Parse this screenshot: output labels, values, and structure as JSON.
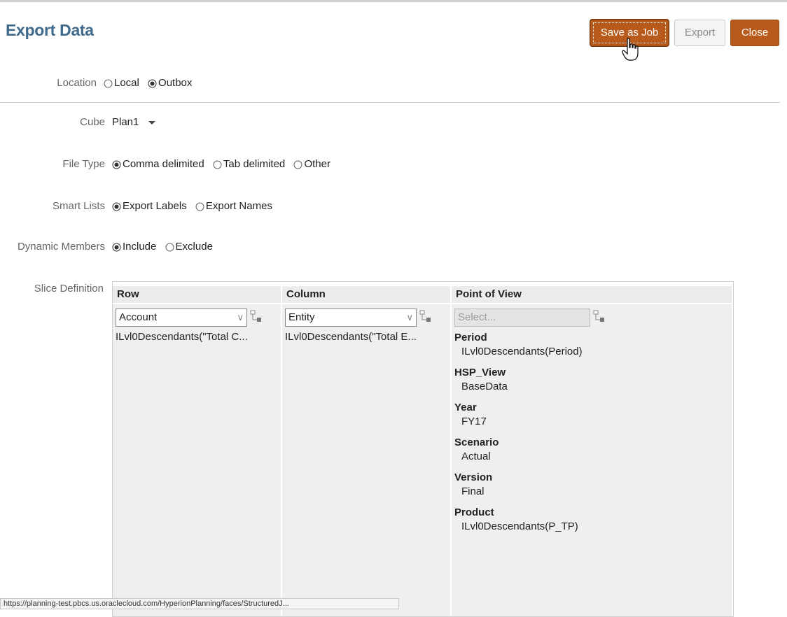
{
  "header": {
    "title": "Export Data",
    "buttons": {
      "save_as_job": "Save as Job",
      "export": "Export",
      "close": "Close"
    },
    "accent_color": "#b85a1c",
    "title_color": "#3f6a8c"
  },
  "form": {
    "location": {
      "label": "Location",
      "options": [
        "Local",
        "Outbox"
      ],
      "selected": "Outbox"
    },
    "cube": {
      "label": "Cube",
      "value": "Plan1"
    },
    "file_type": {
      "label": "File Type",
      "options": [
        "Comma delimited",
        "Tab delimited",
        "Other"
      ],
      "selected": "Comma delimited"
    },
    "smart_lists": {
      "label": "Smart Lists",
      "options": [
        "Export Labels",
        "Export Names"
      ],
      "selected": "Export Labels"
    },
    "dynamic_members": {
      "label": "Dynamic Members",
      "options": [
        "Include",
        "Exclude"
      ],
      "selected": "Include"
    },
    "slice_definition": {
      "label": "Slice Definition",
      "row": {
        "header": "Row",
        "dimension": "Account",
        "expression": "ILvl0Descendants(\"Total C..."
      },
      "column": {
        "header": "Column",
        "dimension": "Entity",
        "expression": "ILvl0Descendants(\"Total E..."
      },
      "pov": {
        "header": "Point of View",
        "placeholder": "Select...",
        "members": [
          {
            "dimension": "Period",
            "member": "ILvl0Descendants(Period)"
          },
          {
            "dimension": "HSP_View",
            "member": "BaseData"
          },
          {
            "dimension": "Year",
            "member": "FY17"
          },
          {
            "dimension": "Scenario",
            "member": "Actual"
          },
          {
            "dimension": "Version",
            "member": "Final"
          },
          {
            "dimension": "Product",
            "member": "ILvl0Descendants(P_TP)"
          }
        ]
      }
    }
  },
  "status_bar": {
    "text": "https://planning-test.pbcs.us.oraclecloud.com/HyperionPlanning/faces/StructuredJ..."
  }
}
